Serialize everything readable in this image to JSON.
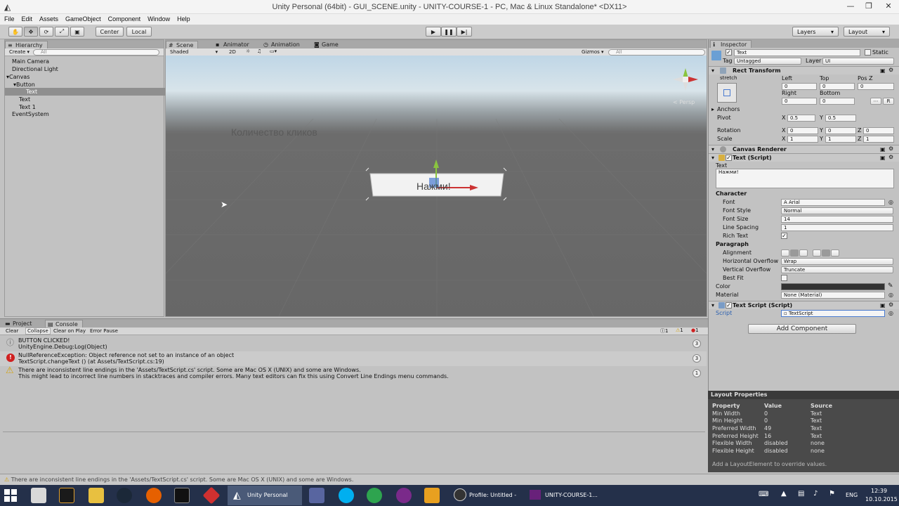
{
  "window": {
    "title": "Unity Personal (64bit) - GUI_SCENE.unity - UNITY-COURSE-1 - PC, Mac & Linux Standalone* <DX11>",
    "controls": [
      "—",
      "❐",
      "✕"
    ]
  },
  "menu": [
    "File",
    "Edit",
    "Assets",
    "GameObject",
    "Component",
    "Window",
    "Help"
  ],
  "toolbar": {
    "pivot_label": "Center",
    "space_label": "Local",
    "layers_label": "Layers",
    "layout_label": "Layout"
  },
  "hierarchy": {
    "tab": "Hierarchy",
    "create_label": "Create",
    "search_placeholder": "All",
    "items": [
      {
        "label": "Main Camera"
      },
      {
        "label": "Directional Light"
      },
      {
        "label": "Canvas"
      },
      {
        "label": "Button"
      },
      {
        "label": "Text"
      },
      {
        "label": "Text"
      },
      {
        "label": "Text 1"
      },
      {
        "label": "EventSystem"
      }
    ]
  },
  "scene": {
    "tabs": [
      "Scene",
      "Animator",
      "Animation",
      "Game"
    ],
    "shading": "Shaded",
    "mode_2d": "2D",
    "gizmos_label": "Gizmos",
    "search_placeholder": "All",
    "persp_label": "< Persp",
    "world_text": "Количество кликов",
    "button_text": "Нажми!"
  },
  "inspector": {
    "tab": "Inspector",
    "object_name": "Text",
    "static_label": "Static",
    "tag_label": "Tag",
    "tag_value": "Untagged",
    "layer_label": "Layer",
    "layer_value": "UI",
    "rect_transform": {
      "title": "Rect Transform",
      "anchor_preset": "stretch",
      "left_label": "Left",
      "top_label": "Top",
      "posz_label": "Pos Z",
      "left": "0",
      "top": "0",
      "posz": "0",
      "right_label": "Right",
      "bottom_label": "Bottom",
      "right": "0",
      "bottom": "0",
      "raw_btn": "R",
      "anchors_label": "Anchors",
      "pivot_label": "Pivot",
      "pivot_x": "0.5",
      "pivot_y": "0.5",
      "rotation_label": "Rotation",
      "rot_x": "0",
      "rot_y": "0",
      "rot_z": "0",
      "scale_label": "Scale",
      "scale_x": "1",
      "scale_y": "1",
      "scale_z": "1"
    },
    "canvas_renderer": "Canvas Renderer",
    "text_script": {
      "title": "Text (Script)",
      "text_label": "Text",
      "text_value": "Нажми!",
      "character_label": "Character",
      "font_label": "Font",
      "font_value": "Arial",
      "font_style_label": "Font Style",
      "font_style_value": "Normal",
      "font_size_label": "Font Size",
      "font_size_value": "14",
      "line_spacing_label": "Line Spacing",
      "line_spacing_value": "1",
      "rich_text_label": "Rich Text",
      "rich_text_checked": true,
      "paragraph_label": "Paragraph",
      "alignment_label": "Alignment",
      "horiz_overflow_label": "Horizontal Overflow",
      "horiz_overflow_value": "Wrap",
      "vert_overflow_label": "Vertical Overflow",
      "vert_overflow_value": "Truncate",
      "best_fit_label": "Best Fit",
      "best_fit_checked": false,
      "color_label": "Color",
      "color_value": "#323232",
      "material_label": "Material",
      "material_value": "None (Material)"
    },
    "custom_script": {
      "title": "Text Script (Script)",
      "script_label": "Script",
      "script_value": "TextScript"
    },
    "add_component": "Add Component"
  },
  "layout_properties": {
    "title": "Layout Properties",
    "headers": [
      "Property",
      "Value",
      "Source"
    ],
    "rows": [
      [
        "Min Width",
        "0",
        "Text"
      ],
      [
        "Min Height",
        "0",
        "Text"
      ],
      [
        "Preferred Width",
        "49",
        "Text"
      ],
      [
        "Preferred Height",
        "16",
        "Text"
      ],
      [
        "Flexible Width",
        "disabled",
        "none"
      ],
      [
        "Flexible Height",
        "disabled",
        "none"
      ]
    ],
    "footer": "Add a LayoutElement to override values."
  },
  "console": {
    "tabs": [
      "Project",
      "Console"
    ],
    "buttons": [
      "Clear",
      "Collapse",
      "Clear on Play",
      "Error Pause"
    ],
    "counts": {
      "info": "1",
      "warning": "1",
      "error": "1"
    },
    "entries": [
      {
        "type": "info",
        "line1": "BUTTON CLICKED!",
        "line2": "UnityEngine.Debug:Log(Object)",
        "count": "3"
      },
      {
        "type": "error",
        "line1": "NullReferenceException: Object reference not set to an instance of an object",
        "line2": "TextScript.changeText () (at Assets/TextScript.cs:19)",
        "count": "3"
      },
      {
        "type": "warning",
        "line1": "There are inconsistent line endings in the 'Assets/TextScript.cs' script. Some are Mac OS X (UNIX) and some are Windows.",
        "line2": "This might lead to incorrect line numbers in stacktraces and compiler errors. Many text editors can fix this using Convert Line Endings menu commands.",
        "count": "1"
      }
    ]
  },
  "statusbar": "There are inconsistent line endings in the 'Assets/TextScript.cs' script. Some are Mac OS X (UNIX) and some are Windows.",
  "taskbar": {
    "windows": [
      {
        "label": "Unity Personal (64..."
      },
      {
        "label": "Profile: Untitled - ..."
      },
      {
        "label": "UNITY-COURSE-1..."
      }
    ],
    "lang": "ENG",
    "time": "12:39",
    "date": "10.10.2015"
  }
}
